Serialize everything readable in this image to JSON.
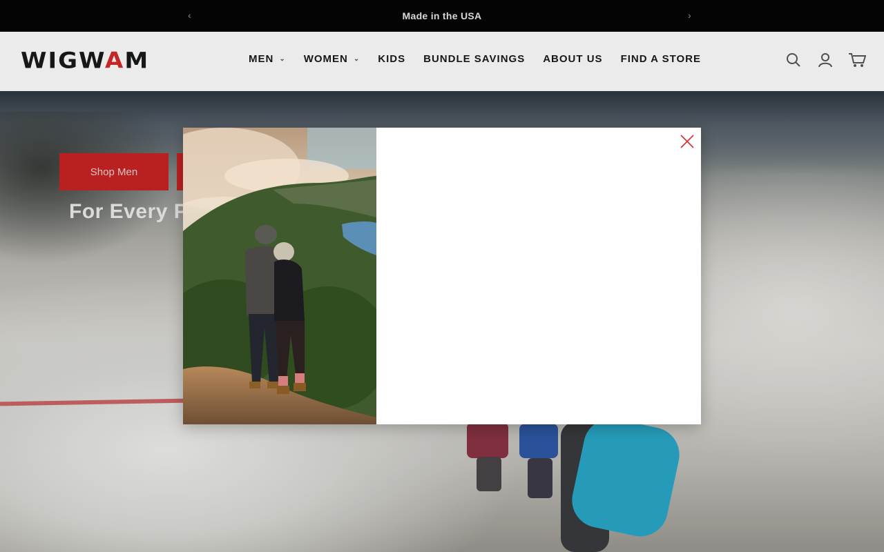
{
  "announcement": {
    "text": "Made in the USA",
    "prev_icon": "chevron-left-icon",
    "next_icon": "chevron-right-icon"
  },
  "header": {
    "logo": {
      "left": "WIGW",
      "accent": "A",
      "right": "M"
    },
    "nav": [
      {
        "label": "MEN",
        "has_dropdown": true
      },
      {
        "label": "WOMEN",
        "has_dropdown": true
      },
      {
        "label": "KIDS",
        "has_dropdown": false
      },
      {
        "label": "BUNDLE SAVINGS",
        "has_dropdown": false
      },
      {
        "label": "ABOUT US",
        "has_dropdown": false
      },
      {
        "label": "FIND A STORE",
        "has_dropdown": false
      }
    ],
    "icons": [
      "search-icon",
      "account-icon",
      "cart-icon"
    ]
  },
  "hero": {
    "button_label": "Shop Men",
    "tagline": "For Every P"
  },
  "modal": {
    "image_alt": "Couple overlooking a forested valley and lake at sunrise",
    "close_icon": "close-icon",
    "colors": {
      "close": "#d52b2b"
    }
  },
  "colors": {
    "brand_red": "#c92424",
    "announcement_bg": "#050505"
  }
}
